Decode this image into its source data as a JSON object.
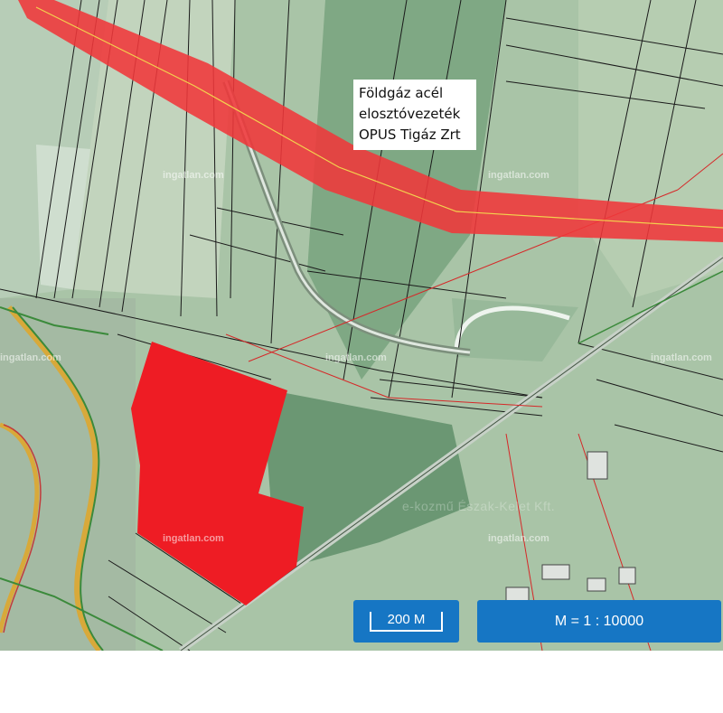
{
  "map": {
    "pipeline_label": {
      "lines": [
        "Földgáz acél",
        "elosztóvezeték",
        "OPUS Tigáz Zrt"
      ]
    },
    "watermark": "ingatlan.com",
    "owner_ghost": "e-kozmű Észak-Kelet Kft.",
    "colors": {
      "pipeline": "#f0373a",
      "parcel": "#ee1c24",
      "scale_button": "#1676c4"
    }
  },
  "controls": {
    "scale_bar_label": "200 M",
    "ratio_label": "M = 1 : 10000"
  }
}
